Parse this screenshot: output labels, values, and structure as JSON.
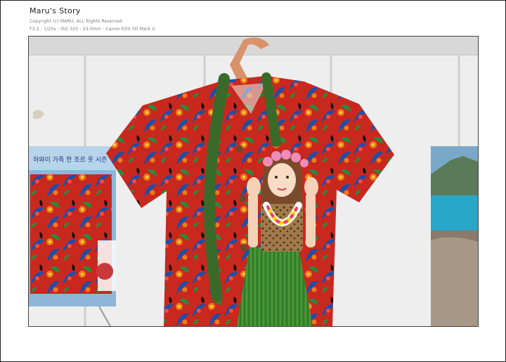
{
  "header": {
    "title": "Maru's Story",
    "copyright": "Copyright (c) MARU, ALL Rights Reserved",
    "exif": "F3.2 : 1/25s : ISO 320 : 23.0mm : Canon EOS 5D Mark II"
  },
  "poster": {
    "heading": "하와이 가족 한 조르 옷 시즌"
  },
  "colors": {
    "shirt_base": "#c8281e",
    "leaf_blue": "#1e4fa8",
    "leaf_green": "#2a8a3a",
    "flower_orange": "#f07a18",
    "skirt_green": "#3c8a2e",
    "hanger": "#d9926a",
    "sea": "#2aa6c8"
  }
}
